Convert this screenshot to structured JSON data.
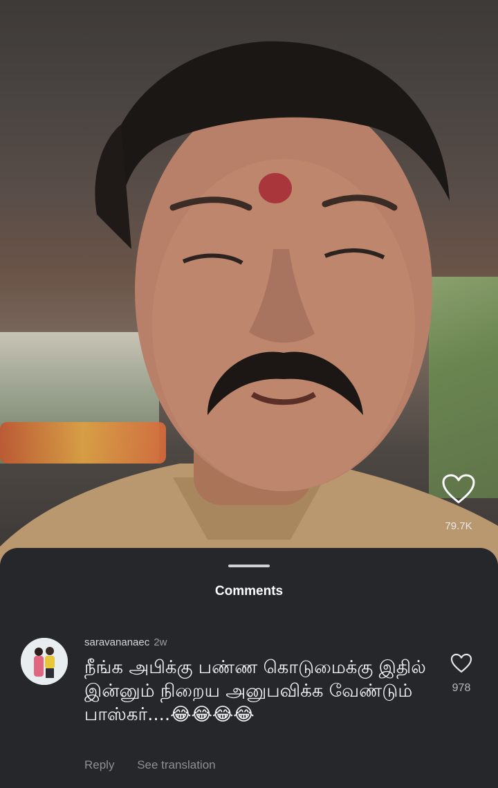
{
  "video": {
    "like_count": "79.7K",
    "icons": {
      "like": "heart-outline-icon"
    }
  },
  "comments_sheet": {
    "title": "Comments",
    "comments": [
      {
        "username": "saravananaec",
        "age": "2w",
        "text": "நீங்க அபிக்கு பண்ண கொடுமைக்கு இதில் இன்னும் நிறைய அனுபவிக்க வேண்டும் பாஸ்கர்....😂😂😂😂",
        "like_count": "978",
        "reply_label": "Reply",
        "translate_label": "See translation"
      }
    ]
  }
}
